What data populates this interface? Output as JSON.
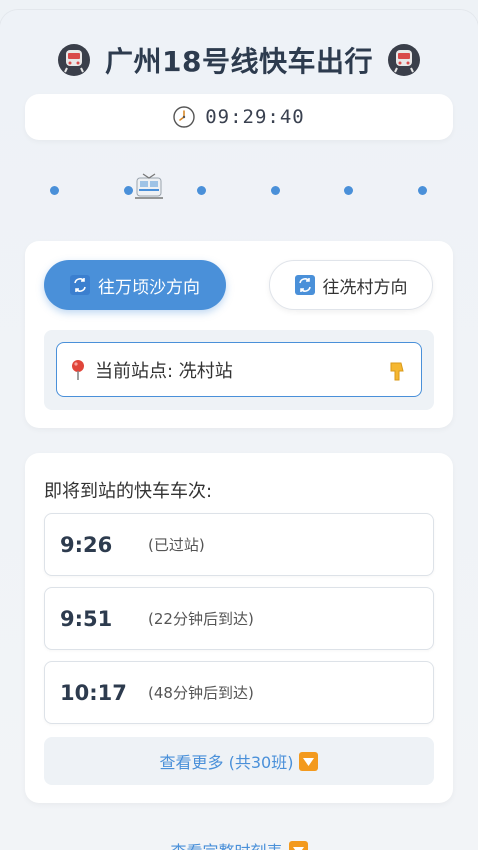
{
  "header": {
    "title": "广州18号线快车出行",
    "left_icon": "metro-train-icon",
    "right_icon": "metro-train-icon"
  },
  "clock": {
    "icon": "clock-icon",
    "time": "09:29:40"
  },
  "track": {
    "train_icon": "train-icon",
    "accent_color": "#4a90d9"
  },
  "directions": {
    "active_label": "往万顷沙方向",
    "inactive_label": "往冼村方向",
    "icon": "swap-icon",
    "active_color": "#4a90d9"
  },
  "station": {
    "label": "当前站点: 冼村站",
    "pin_icon": "pin-icon",
    "hand_icon": "hand-pointing-down-icon"
  },
  "upcoming": {
    "heading": "即将到站的快车车次:",
    "rows": [
      {
        "time": "9:26",
        "status": "(已过站)"
      },
      {
        "time": "9:51",
        "status": "(22分钟后到达)"
      },
      {
        "time": "10:17",
        "status": "(48分钟后到达)"
      }
    ],
    "more_label": "查看更多 (共30班)",
    "more_icon": "down-arrow-icon"
  },
  "footer": {
    "link_label": "查看完整时刻表",
    "link_icon": "down-arrow-icon"
  }
}
